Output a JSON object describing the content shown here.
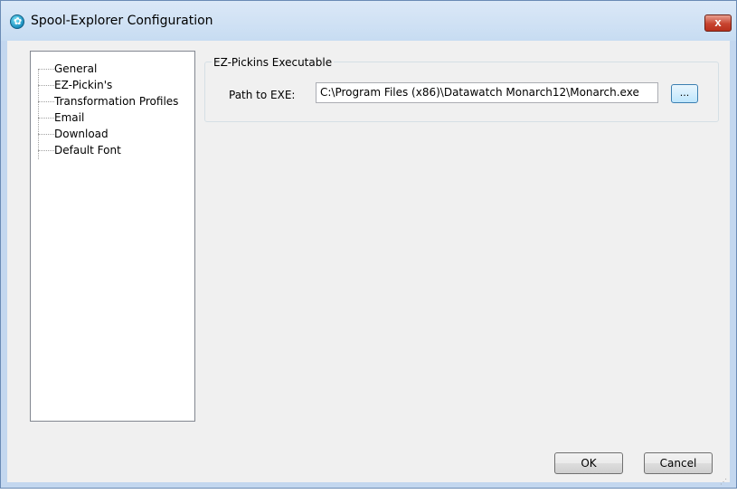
{
  "window": {
    "title": "Spool-Explorer Configuration",
    "close_label": "x"
  },
  "tree": {
    "items": [
      {
        "label": "General"
      },
      {
        "label": "EZ-Pickin's"
      },
      {
        "label": "Transformation Profiles"
      },
      {
        "label": "Email"
      },
      {
        "label": "Download"
      },
      {
        "label": "Default Font"
      }
    ]
  },
  "group": {
    "title": "EZ-Pickins Executable",
    "path_label": "Path to EXE:",
    "path_value": "C:\\Program Files (x86)\\Datawatch Monarch12\\Monarch.exe",
    "browse_label": "..."
  },
  "buttons": {
    "ok": "OK",
    "cancel": "Cancel"
  }
}
